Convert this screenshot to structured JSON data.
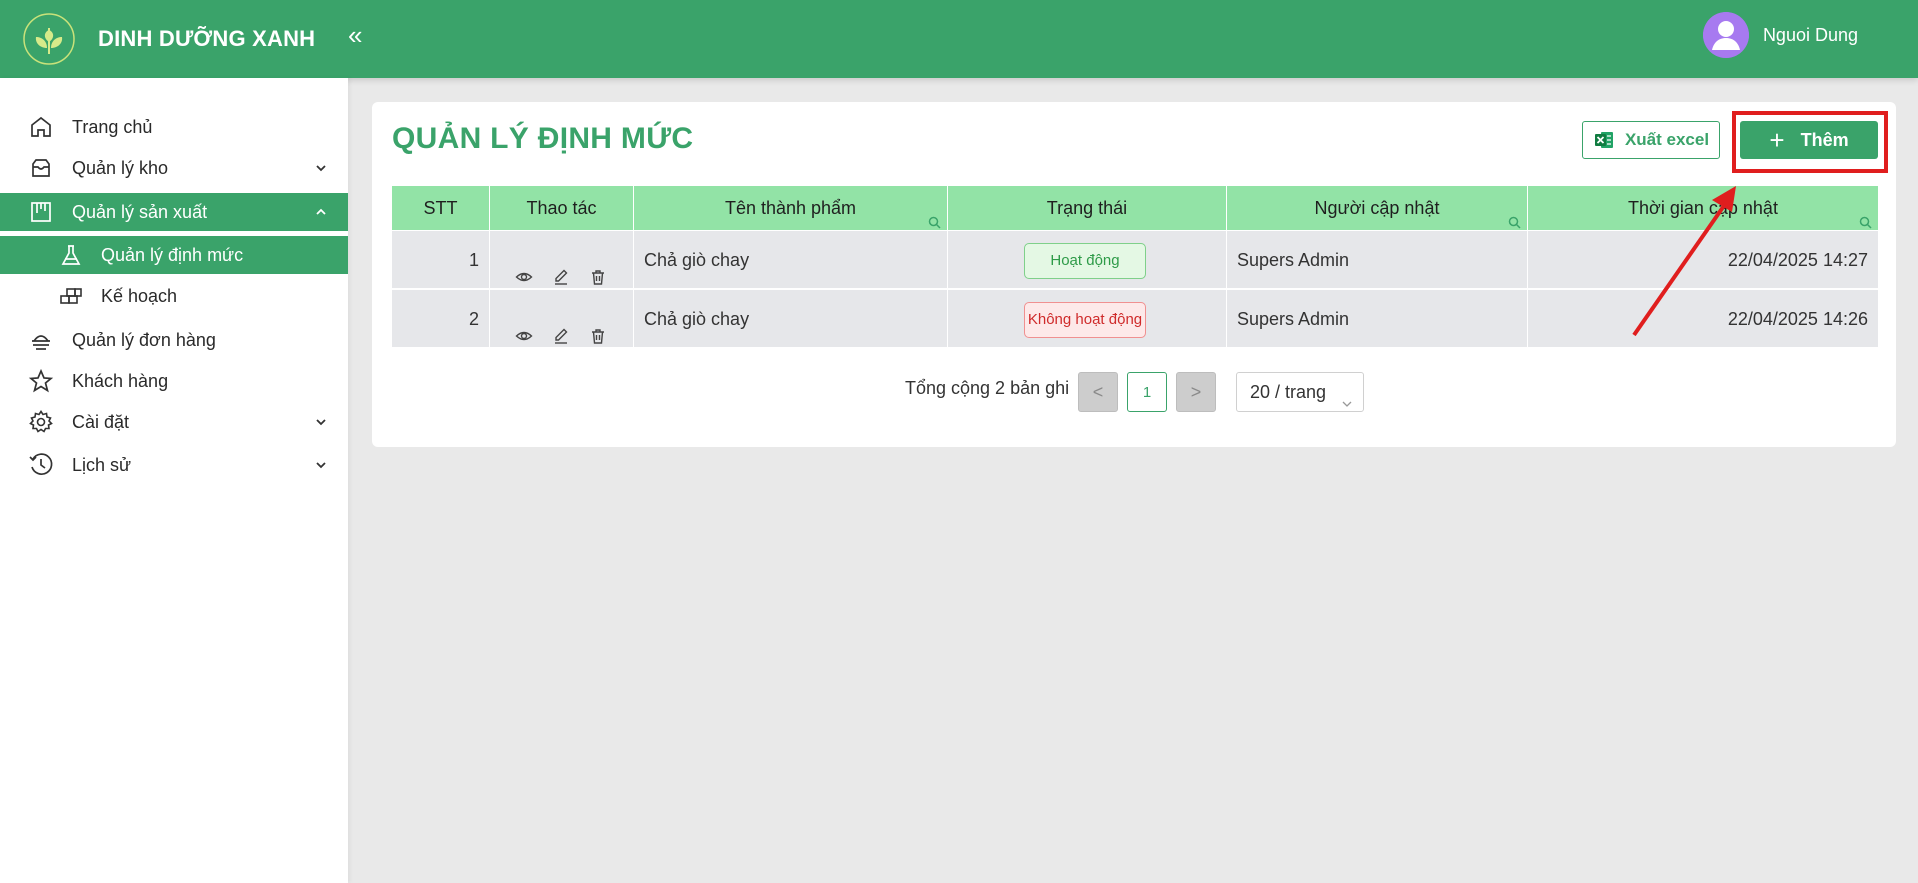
{
  "brand": {
    "name": "DINH DƯỠNG XANH",
    "logo_icon": "leaf-logo-icon",
    "collapse_glyph": "«"
  },
  "user": {
    "name": "Nguoi Dung",
    "avatar_icon": "user-avatar-icon"
  },
  "sidebar": {
    "items": [
      {
        "label": "Trang chủ",
        "icon": "home-icon",
        "expandable": false
      },
      {
        "label": "Quản lý kho",
        "icon": "inbox-icon",
        "expandable": true,
        "expanded": false
      },
      {
        "label": "Quản lý sản xuất",
        "icon": "factory-board-icon",
        "expandable": true,
        "expanded": true,
        "active": true,
        "children": [
          {
            "label": "Quản lý định mức",
            "icon": "flask-icon",
            "active": true
          },
          {
            "label": "Kế hoạch",
            "icon": "bricks-icon",
            "active": false
          }
        ]
      },
      {
        "label": "Quản lý đơn hàng",
        "icon": "dish-icon",
        "expandable": false
      },
      {
        "label": "Khách hàng",
        "icon": "star-icon",
        "expandable": false
      },
      {
        "label": "Cài đặt",
        "icon": "gear-icon",
        "expandable": true,
        "expanded": false
      },
      {
        "label": "Lịch sử",
        "icon": "clock-icon",
        "expandable": true,
        "expanded": false
      }
    ]
  },
  "page": {
    "title": "QUẢN LÝ ĐỊNH MỨC",
    "export_label": "Xuất excel",
    "add_label": "Thêm",
    "add_highlight_color": "#e01e1e"
  },
  "table": {
    "columns": [
      "STT",
      "Thao tác",
      "Tên thành phẩm",
      "Trạng thái",
      "Người cập nhật",
      "Thời gian cập nhật"
    ],
    "rows": [
      {
        "stt": "1",
        "name": "Chả giò chay",
        "status": "Hoạt động",
        "status_type": "active",
        "updated_by": "Supers Admin",
        "updated_at": "22/04/2025 14:27"
      },
      {
        "stt": "2",
        "name": "Chả giò chay",
        "status": "Không hoạt động",
        "status_type": "inactive",
        "updated_by": "Supers Admin",
        "updated_at": "22/04/2025 14:26"
      }
    ]
  },
  "pagination": {
    "total_text": "Tổng cộng 2 bản ghi",
    "prev": "<",
    "current_page": "1",
    "next": ">",
    "page_size": "20 / trang"
  },
  "colors": {
    "primary": "#3aa36a",
    "header_row": "#92e3a6",
    "row_bg": "#e6e7ea",
    "active_badge": "#2e9b48",
    "inactive_badge": "#cf2b2b"
  }
}
